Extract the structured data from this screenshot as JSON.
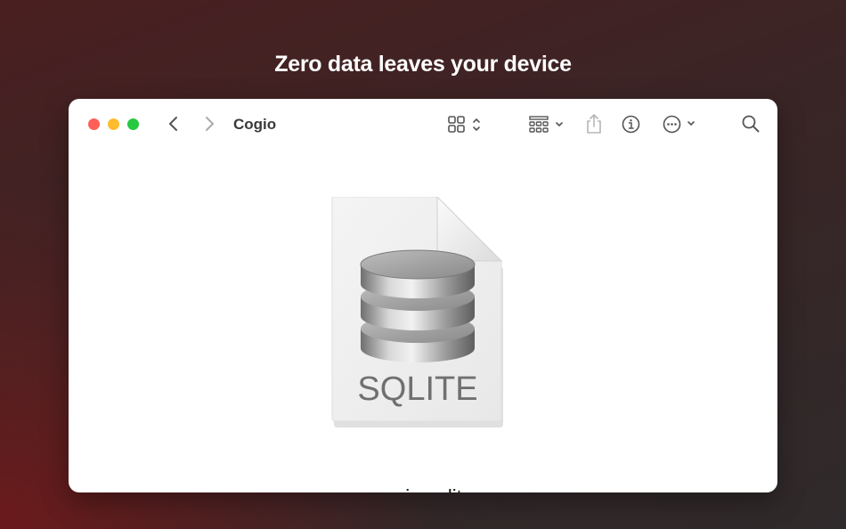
{
  "headline": "Zero data leaves your device",
  "window": {
    "title": "Cogio",
    "toolbar": {
      "icons": [
        "back-chevron",
        "forward-chevron",
        "grid-view-selector",
        "group-by-menu",
        "share",
        "info",
        "more-actions",
        "search"
      ]
    },
    "traffic_lights": {
      "close": "#ff5f57",
      "minimize": "#febc2e",
      "zoom": "#28c840"
    }
  },
  "file": {
    "name": "cogio.sqlite",
    "type_label": "SQLITE",
    "icon": "database-document-icon"
  }
}
